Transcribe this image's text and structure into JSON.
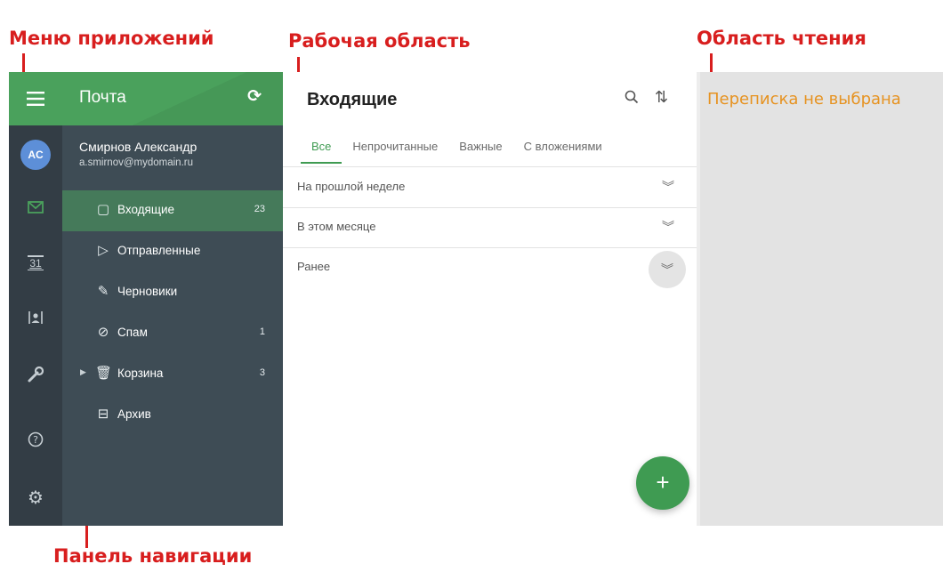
{
  "annotations": {
    "apps_menu": "Меню приложений",
    "work_area": "Рабочая область",
    "reading_area": "Область чтения",
    "nav_panel": "Панель навигации"
  },
  "header": {
    "title": "Почта",
    "menu_icon": "hamburger-icon",
    "refresh_icon": "refresh-icon"
  },
  "user": {
    "initials": "AC",
    "name": "Смирнов Александр",
    "email": "a.smirnov@mydomain.ru"
  },
  "folders": [
    {
      "label": "Входящие",
      "count": "23",
      "icon": "inbox-icon",
      "active": true
    },
    {
      "label": "Отправленные",
      "count": "",
      "icon": "send-icon"
    },
    {
      "label": "Черновики",
      "count": "",
      "icon": "draft-icon"
    },
    {
      "label": "Спам",
      "count": "1",
      "icon": "spam-icon"
    },
    {
      "label": "Корзина",
      "count": "3",
      "icon": "trash-icon",
      "expandable": true
    },
    {
      "label": "Архив",
      "count": "",
      "icon": "archive-icon"
    }
  ],
  "rail": [
    "mail-icon",
    "calendar-icon",
    "contacts-icon",
    "wrench-icon",
    "help-icon",
    "settings-icon"
  ],
  "rail_calendar_text": "31",
  "work": {
    "title": "Входящие",
    "tabs": [
      "Все",
      "Непрочитанные",
      "Важные",
      "С вложениями"
    ],
    "groups": [
      "На прошлой неделе",
      "В этом месяце",
      "Ранее"
    ],
    "fab_label": "+"
  },
  "reading": {
    "empty_message": "Переписка не выбрана"
  },
  "colors": {
    "accent": "#4aa15c",
    "nav_bg": "#3e4c55",
    "rail_bg": "#333d45",
    "active_folder": "#457a5a",
    "annotation": "#d81e1e",
    "empty_text": "#e69322"
  }
}
